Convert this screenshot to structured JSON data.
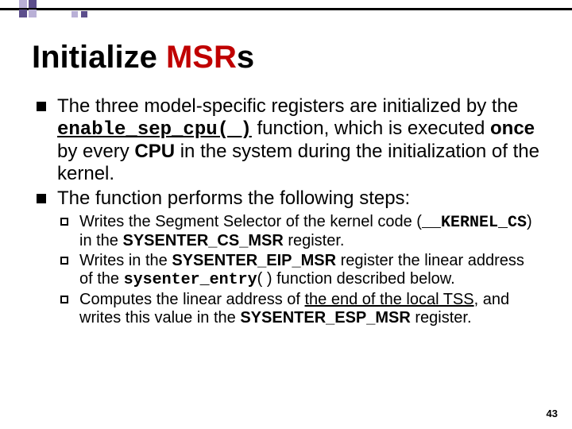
{
  "title": {
    "pre": "Initialize ",
    "hl": "MSR",
    "post": "s"
  },
  "bullets": {
    "b1": {
      "t1": "The three model-specific registers are initialized by the ",
      "code1": "enable_sep_cpu( )",
      "t2": " function, which is executed ",
      "bold1": "once",
      "t3": " by every ",
      "bold2": "CPU",
      "t4": " in the system during the initialization of the kernel."
    },
    "b2": {
      "t1": "The function performs the following steps:",
      "s1": {
        "t1": "Writes the Segment Selector of the kernel code (",
        "code1": "__KERNEL_CS",
        "t2": ") in the ",
        "bold1": "SYSENTER_CS_MSR",
        "t3": " register."
      },
      "s2": {
        "t1": "Writes in the ",
        "bold1": "SYSENTER_EIP_MSR",
        "t2": " register the linear address of the ",
        "code1": "sysenter_entry",
        "t3": "( ) function described below."
      },
      "s3": {
        "t1": "Computes the linear address of ",
        "u1": "the end of the local TSS",
        "t2": ", and writes this value in the ",
        "bold1": "SYSENTER_ESP_MSR",
        "t3": " register."
      }
    }
  },
  "page": "43"
}
